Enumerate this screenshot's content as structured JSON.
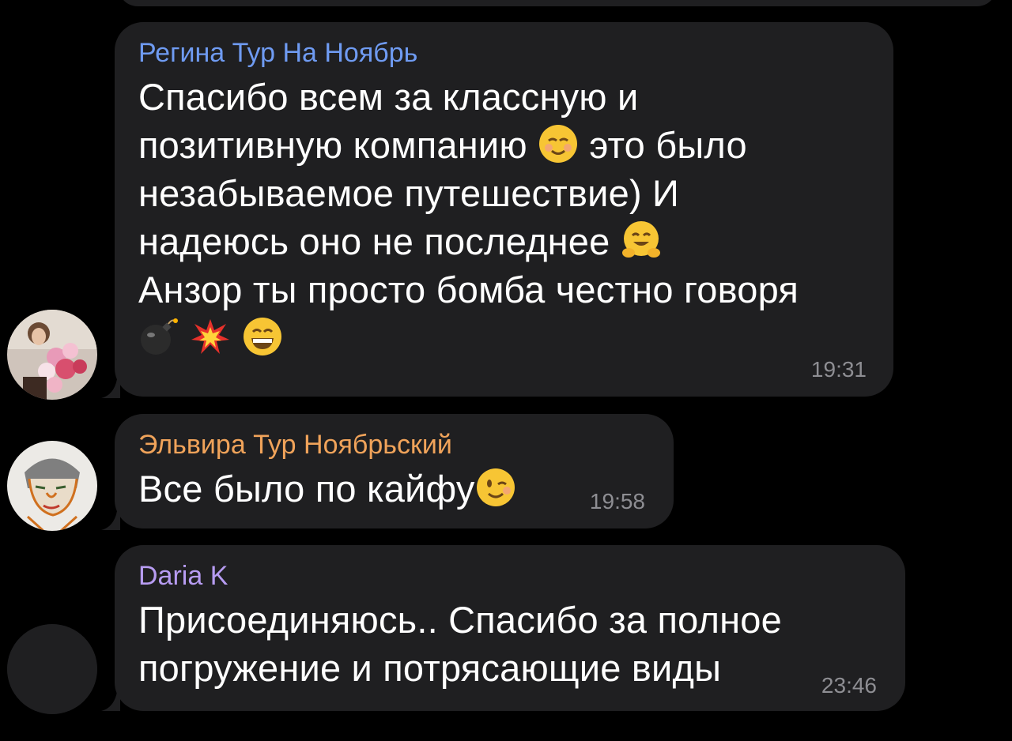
{
  "messages": [
    {
      "sender": "Регина Тур На Ноябрь",
      "sender_color": "#6f9bf2",
      "lines": [
        "Спасибо всем за классную и",
        "позитивную компанию",
        "это было",
        "незабываемое путешествие) И",
        "надеюсь оно не последнее",
        "Анзор ты просто бомба честно говоря"
      ],
      "time": "19:31",
      "avatar": "photo-flowers-avatar"
    },
    {
      "sender": "Эльвира Тур Ноябрьский",
      "sender_color": "#f0a35a",
      "lines": [
        "Все было по кайфу"
      ],
      "time": "19:58",
      "avatar": "drawing-portrait-avatar"
    },
    {
      "sender": "Daria K",
      "sender_color": "#b79cf2",
      "lines": [
        "Присоединяюсь.. Спасибо за полное",
        "погружение и потрясающие виды"
      ],
      "time": "23:46",
      "avatar": "empty-avatar"
    }
  ]
}
